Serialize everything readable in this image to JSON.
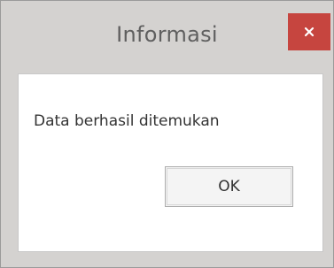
{
  "window": {
    "title": "Informasi"
  },
  "titlebar": {
    "close_icon": "close-icon"
  },
  "dialog": {
    "message": "Data berhasil ditemukan",
    "ok_label": "OK"
  },
  "colors": {
    "frame": "#d4d2d0",
    "close_button": "#c6453f",
    "content_background": "#ffffff",
    "title_text": "#5f5f5f"
  }
}
